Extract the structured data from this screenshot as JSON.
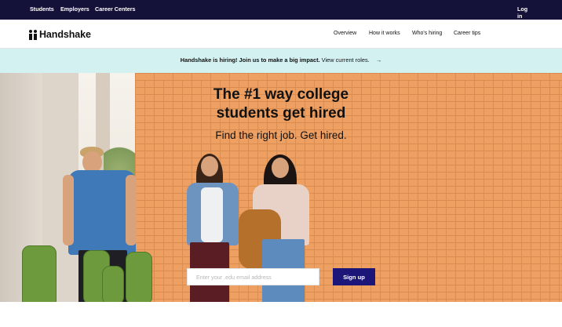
{
  "topbar": {
    "links": [
      "Students",
      "Employers",
      "Career Centers"
    ],
    "login": "Log in"
  },
  "header": {
    "brand": "Handshake",
    "nav": [
      "Overview",
      "How it works",
      "Who's hiring",
      "Career tips"
    ]
  },
  "banner": {
    "bold_text": "Handshake is hiring! Join us to make a big impact.",
    "link_text": "View current roles.",
    "arrow": "→"
  },
  "hero": {
    "headline_line1": "The #1 way college",
    "headline_line2": "students get hired",
    "subhead": "Find the right job. Get hired."
  },
  "signup": {
    "email_placeholder": "Enter your .edu email address",
    "button_label": "Sign up"
  },
  "colors": {
    "topbar_bg": "#15123a",
    "banner_bg": "#d4f1f2",
    "button_bg": "#1c1678",
    "wall": "#eea063"
  }
}
